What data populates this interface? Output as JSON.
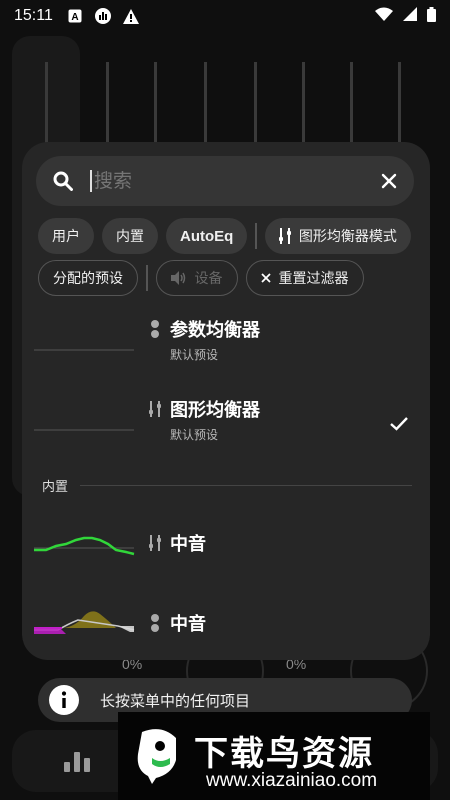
{
  "status_bar": {
    "time": "15:11",
    "icons": [
      "a-badge-icon",
      "chart-icon",
      "warning-icon"
    ],
    "right_icons": [
      "wifi-icon",
      "signal-icon",
      "battery-icon"
    ]
  },
  "background": {
    "percent_left": "0%",
    "percent_right": "0%"
  },
  "search": {
    "placeholder": "搜索"
  },
  "filter_chips_row1": [
    "用户",
    "内置",
    "AutoEq",
    "图形均衡器模式"
  ],
  "filter_chips_row2": {
    "assigned": "分配的预设",
    "device": "设备",
    "reset": "重置过滤器"
  },
  "presets": [
    {
      "title": "参数均衡器",
      "subtitle": "默认预设",
      "type_icon": "parametric-eq-icon",
      "selected": false
    },
    {
      "title": "图形均衡器",
      "subtitle": "默认预设",
      "type_icon": "graphic-eq-icon",
      "selected": true
    }
  ],
  "builtin_section": {
    "label": "内置",
    "items": [
      {
        "title": "中音",
        "type_icon": "graphic-eq-icon",
        "curve_color": "#31d63a"
      },
      {
        "title": "中音",
        "type_icon": "parametric-eq-icon",
        "curve_color": "#c21fc9"
      }
    ]
  },
  "toast": {
    "text": "长按菜单中的任何项目"
  },
  "watermark": {
    "title": "下载鸟资源",
    "url": "www.xiazainiao.com"
  },
  "colors": {
    "dialog_bg": "#262626",
    "chip_bg": "#3a3a3a",
    "accent_green": "#31d63a",
    "accent_magenta": "#c21fc9"
  }
}
